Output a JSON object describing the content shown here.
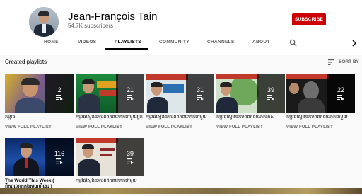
{
  "channel": {
    "name": "Jean-François Tain",
    "subscribers": "54.7K subscribers",
    "subscribe_label": "SUBSCRIBE"
  },
  "tabs": [
    {
      "label": "HOME",
      "active": false
    },
    {
      "label": "VIDEOS",
      "active": false
    },
    {
      "label": "PLAYLISTS",
      "active": true
    },
    {
      "label": "COMMUNITY",
      "active": false
    },
    {
      "label": "CHANNELS",
      "active": false
    },
    {
      "label": "ABOUT",
      "active": false
    }
  ],
  "section": {
    "title": "Created playlists",
    "sort_label": "SORT BY"
  },
  "playlists": [
    {
      "title": "កម្មវិធ",
      "count": "2",
      "view_label": "VIEW FULL PLAYLIST"
    },
    {
      "title": "កម្មវិធីស្វែងយល់ពីពិភពលោកជាមួយអ្នក",
      "count": "21",
      "view_label": "VIEW FULL PLAYLIST"
    },
    {
      "title": "កម្មវិធីស្វែងយល់ពីពិភពលោកជាមួយ",
      "count": "31",
      "view_label": "VIEW FULL PLAYLIST"
    },
    {
      "title": "កម្មវិធីស្វែងយល់ពីពិភពលោកអាស៊ី",
      "count": "39",
      "view_label": "VIEW FULL PLAYLIST"
    },
    {
      "title": "កម្មវិធីស្វែងយល់ពីពិភពលោកជាមួយ",
      "count": "22",
      "view_label": "VIEW FULL PLAYLIST"
    },
    {
      "title": "The World This Week ( ពិភពលោកក្នុងសប្តាហ៍នេះ )",
      "count": "116",
      "view_label": ""
    },
    {
      "title": "កម្មវិធីស្វែងយល់ពីពិភពលោកជាមួយ",
      "count": "39",
      "view_label": ""
    }
  ],
  "icons": {
    "search": "search-icon",
    "chevron": "chevron-right-icon",
    "sort": "sort-icon",
    "playlist": "playlist-icon"
  },
  "colors": {
    "subscribe": "#cc0000",
    "active_tab": "#030303",
    "inactive_tab": "#606060"
  }
}
